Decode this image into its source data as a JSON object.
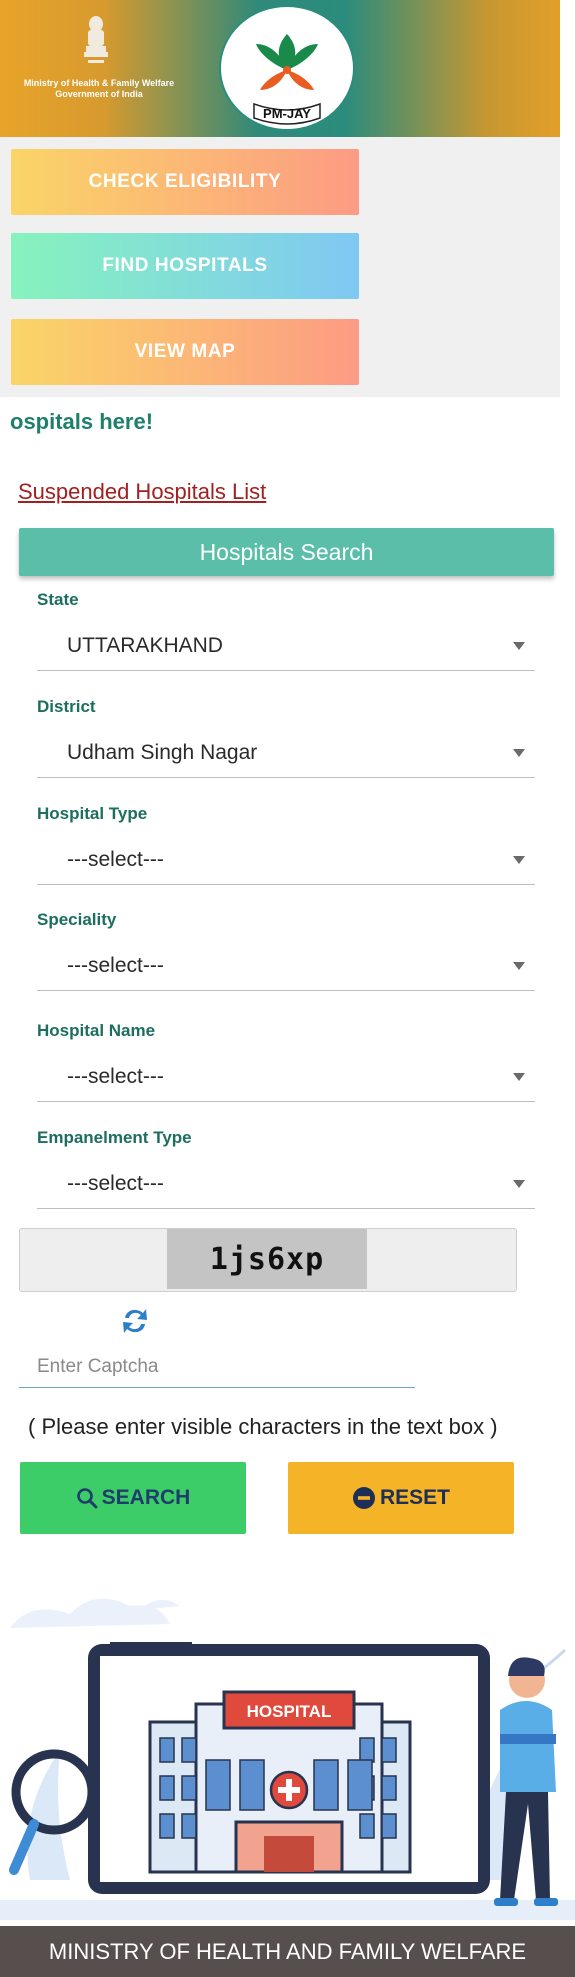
{
  "header": {
    "ministry_line1": "Ministry of Health & Family Welfare",
    "ministry_line2": "Government of India",
    "logo_text": "PM-JAY"
  },
  "nav": {
    "check_eligibility": "CHECK ELIGIBILITY",
    "find_hospitals": "FIND HOSPITALS",
    "view_map": "VIEW MAP"
  },
  "marquee": "ospitals here!",
  "suspended_link": "Suspended Hospitals List",
  "search": {
    "title": "Hospitals Search",
    "fields": [
      {
        "label": "State",
        "value": "UTTARAKHAND"
      },
      {
        "label": "District",
        "value": "Udham Singh Nagar"
      },
      {
        "label": "Hospital Type",
        "value": "---select---"
      },
      {
        "label": "Speciality",
        "value": "---select---"
      },
      {
        "label": "Hospital Name",
        "value": "---select---"
      },
      {
        "label": "Empanelment Type",
        "value": "---select---"
      }
    ],
    "captcha_text": "1js6xp",
    "captcha_placeholder": "Enter Captcha",
    "hint": "( Please enter visible characters in the text box )",
    "search_label": "SEARCH",
    "reset_label": "RESET"
  },
  "illustration": {
    "sign": "HOSPITAL"
  },
  "footer": "MINISTRY OF HEALTH AND FAMILY WELFARE",
  "colors": {
    "teal": "#5bbea8",
    "label_green": "#1d6e5e",
    "search_green": "#3ccd69",
    "reset_orange": "#f5b427",
    "footer_brown": "#574e4e"
  }
}
